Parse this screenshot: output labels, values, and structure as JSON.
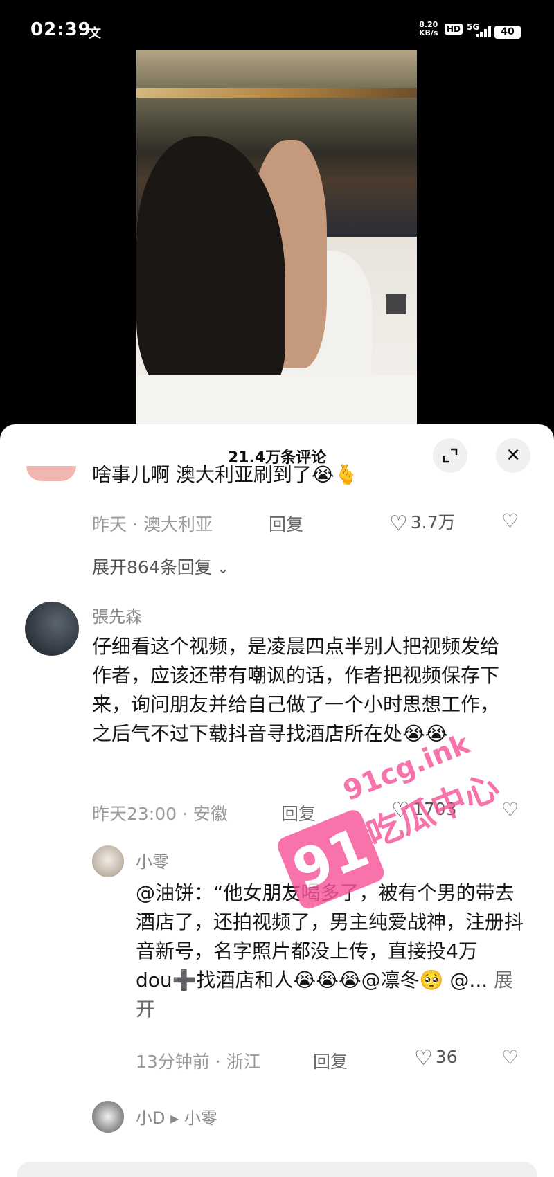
{
  "status_bar": {
    "time": "02:39",
    "ime_indicator": "文",
    "net_speed_value": "8.20",
    "net_speed_unit": "KB/s",
    "hd_label": "HD",
    "network_type": "5G",
    "battery": "40"
  },
  "comments_header": {
    "title": "21.4万条评论",
    "expand_icon": "fullscreen-icon",
    "close_icon": "close-icon"
  },
  "comments": [
    {
      "text": "啥事儿啊 澳大利亚刷到了😭🫰",
      "time": "昨天",
      "location": "澳大利亚",
      "reply_label": "回复",
      "likes": "3.7万",
      "expand_replies": "展开864条回复"
    },
    {
      "author": "張先森",
      "text": "仔细看这个视频，是凌晨四点半别人把视频发给作者，应该还带有嘲讽的话，作者把视频保存下来，询问朋友并给自己做了一个小时思想工作，之后气不过下载抖音寻找酒店所在处😭😭",
      "time": "昨天23:00",
      "location": "安徽",
      "reply_label": "回复",
      "likes": "1703",
      "replies": [
        {
          "author": "小零",
          "text": "@油饼：“他女朋友喝多了，被有个男的带去酒店了，还拍视频了，男主纯爱战神，注册抖音新号，名字照片都没上传，直接投4万dou➕找酒店和人😭😭😭@凛冬🥺 @...",
          "expand_label": "展开",
          "time": "13分钟前",
          "location": "浙江",
          "reply_label": "回复",
          "likes": "36"
        },
        {
          "author": "小D",
          "reply_arrow": "▸",
          "reply_to": "小零"
        }
      ]
    }
  ],
  "watermark": {
    "badge": "91",
    "url": "91cg.ink",
    "label": "吃瓜中心"
  },
  "colors": {
    "watermark_pink": "#f7559a",
    "panel_bg": "#ffffff",
    "status_bar_bg": "#000000"
  }
}
